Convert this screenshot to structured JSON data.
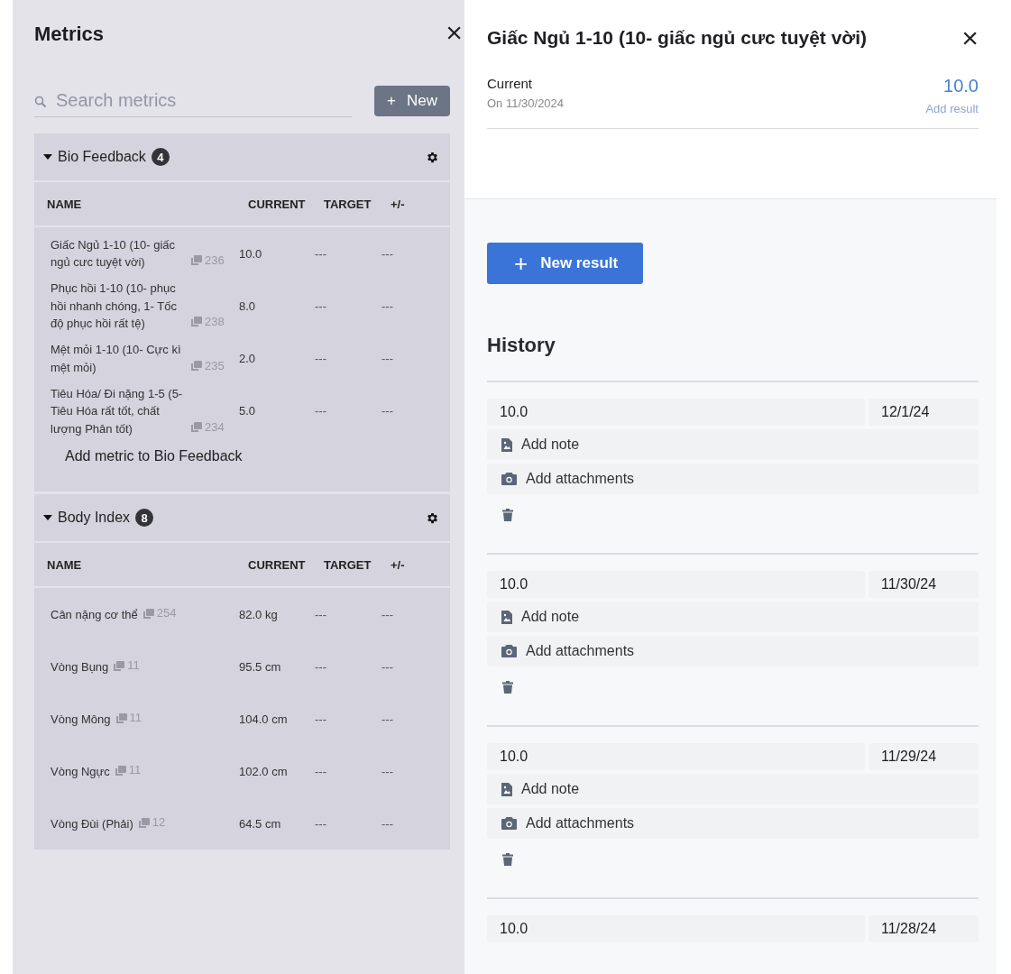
{
  "metrics_panel": {
    "title": "Metrics",
    "close": "×",
    "search": {
      "placeholder": "Search metrics"
    },
    "new_button": {
      "icon": "+",
      "label": "New"
    },
    "groups": [
      {
        "name": "Bio Feedback",
        "count": "4",
        "expanded": true,
        "columns": [
          "NAME",
          "CURRENT",
          "TARGET",
          "+/-"
        ],
        "rows": [
          {
            "name": "Giấc Ngủ 1-10 (10- giấc ngủ cưc tuyệt vời)",
            "entries": "236",
            "current": "10.0",
            "target": "---",
            "diff": "---"
          },
          {
            "name": "Phục hồi 1-10 (10- phục hồi nhanh chóng, 1- Tốc độ phục hồi rất tệ)",
            "entries": "238",
            "current": "8.0",
            "target": "---",
            "diff": "---"
          },
          {
            "name": "Mệt mỏi 1-10 (10- Cực kì mệt mỏi)",
            "entries": "235",
            "current": "2.0",
            "target": "---",
            "diff": "---"
          },
          {
            "name": "Tiêu Hóa/ Đi nặng 1-5 (5- Tiêu Hóa rất tốt, chất lượng Phân tốt)",
            "entries": "234",
            "current": "5.0",
            "target": "---",
            "diff": "---"
          }
        ],
        "add_link": "Add metric to Bio Feedback"
      },
      {
        "name": "Body Index",
        "count": "8",
        "expanded": true,
        "columns": [
          "NAME",
          "CURRENT",
          "TARGET",
          "+/-"
        ],
        "rows": [
          {
            "name": "Cân nặng cơ thể",
            "entries": "254",
            "current": "82.0 kg",
            "target": "---",
            "diff": "---"
          },
          {
            "name": "Vòng Bụng",
            "entries": "11",
            "current": "95.5 cm",
            "target": "---",
            "diff": "---"
          },
          {
            "name": "Vòng Mông",
            "entries": "11",
            "current": "104.0 cm",
            "target": "---",
            "diff": "---"
          },
          {
            "name": "Vòng Ngực",
            "entries": "11",
            "current": "102.0 cm",
            "target": "---",
            "diff": "---"
          },
          {
            "name": "Vòng Đùi (Phải)",
            "entries": "12",
            "current": "64.5 cm",
            "target": "---",
            "diff": "---"
          }
        ]
      }
    ]
  },
  "detail_panel": {
    "title": "Giấc Ngủ 1-10 (10- giấc ngủ cưc tuyệt vời)",
    "close": "×",
    "current_label": "Current",
    "current_date": "On 11/30/2024",
    "current_value": "10.0",
    "add_result_link": "Add result",
    "new_result_button": {
      "icon": "+",
      "label": "New result"
    },
    "history_title": "History",
    "history": [
      {
        "value": "10.0",
        "date": "12/1/24",
        "note": "Add note",
        "attachments": "Add attachments"
      },
      {
        "value": "10.0",
        "date": "11/30/24",
        "note": "Add note",
        "attachments": "Add attachments"
      },
      {
        "value": "10.0",
        "date": "11/29/24",
        "note": "Add note",
        "attachments": "Add attachments"
      },
      {
        "value": "10.0",
        "date": "11/28/24"
      }
    ]
  }
}
